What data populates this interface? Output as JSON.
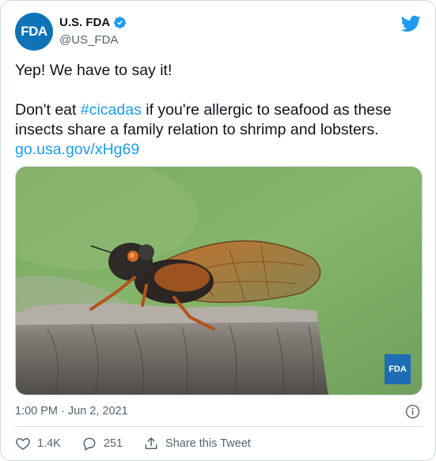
{
  "author": {
    "avatar_text": "FDA",
    "name": "U.S. FDA",
    "handle": "@US_FDA",
    "verified": true
  },
  "tweet": {
    "line1": "Yep! We have to say it!",
    "line2_before": "Don't eat ",
    "hashtag": "#cicadas",
    "line2_after": " if you're allergic to seafood as these insects share a family relation to shrimp and lobsters.",
    "link": "go.usa.gov/xHg69"
  },
  "media": {
    "watermark_text": "FDA"
  },
  "timestamp": "1:00 PM · Jun 2, 2021",
  "actions": {
    "like_count": "1.4K",
    "reply_count": "251",
    "share_label": "Share this Tweet"
  },
  "colors": {
    "link": "#1d9bf0",
    "fda_blue": "#0f73b8",
    "text_secondary": "#536471",
    "twitter_blue": "#1d9bf0"
  },
  "icons": [
    "verified-badge-icon",
    "twitter-bird-icon",
    "info-icon",
    "heart-icon",
    "reply-icon",
    "share-icon"
  ]
}
